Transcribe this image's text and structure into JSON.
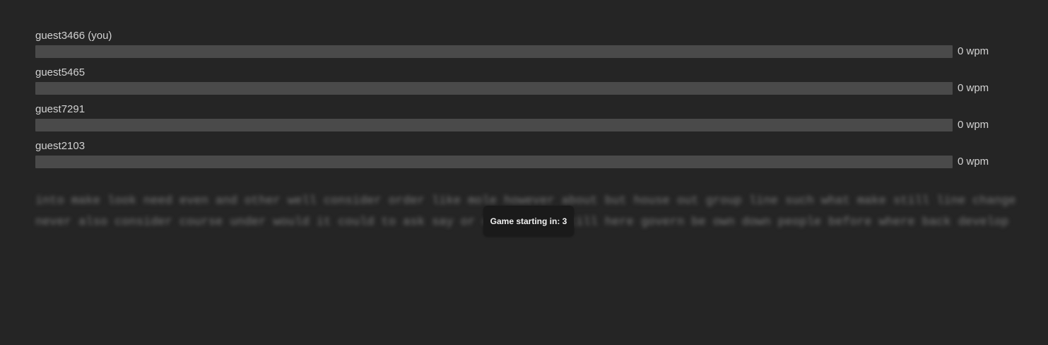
{
  "players": [
    {
      "name": "guest3466 (you)",
      "wpm": "0 wpm",
      "progress": 0
    },
    {
      "name": "guest5465",
      "wpm": "0 wpm",
      "progress": 0
    },
    {
      "name": "guest7291",
      "wpm": "0 wpm",
      "progress": 0
    },
    {
      "name": "guest2103",
      "wpm": "0 wpm",
      "progress": 0
    }
  ],
  "passage": "into make look need even and other well consider order like mole however about but house out group line such what make still line change never also consider course under would it could to ask say or order head still here govern be own down people before where back develop",
  "countdown": {
    "label": "Game starting in: 3"
  },
  "colors": {
    "background": "#252525",
    "track": "#4a4a4a",
    "fill": "#8d8d8d",
    "countdown_bg": "#1a1a1a"
  }
}
